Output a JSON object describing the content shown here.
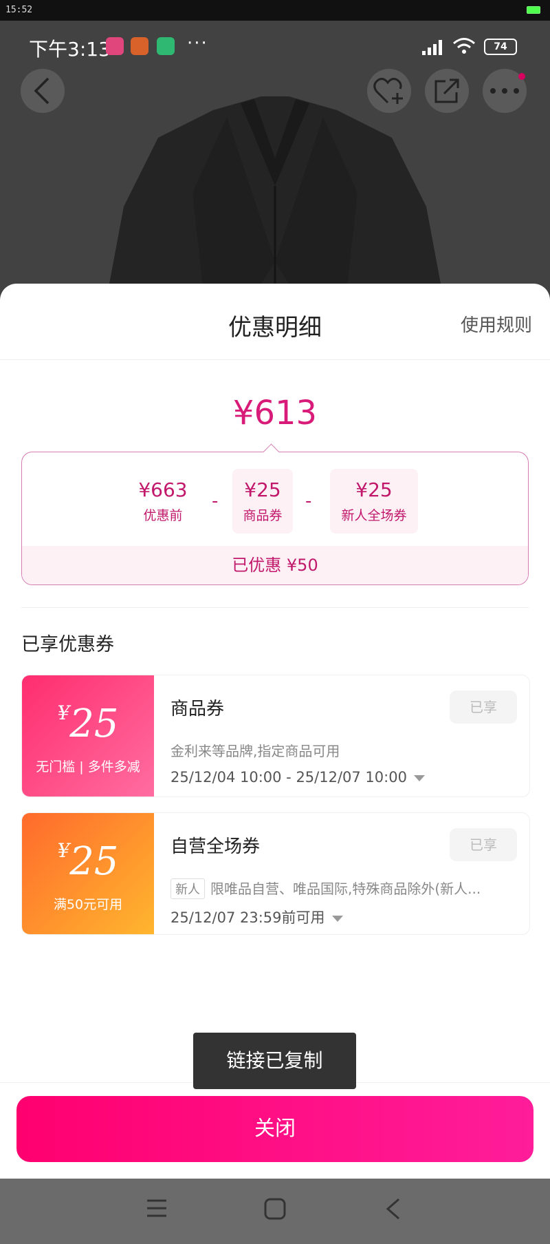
{
  "system_bar": {
    "time": "15:52"
  },
  "phone_status": {
    "time": "下午3:13",
    "more": "···",
    "battery": "74"
  },
  "sheet": {
    "title": "优惠明细",
    "rules_link": "使用规则",
    "final_price": "¥613",
    "breakdown": {
      "items": [
        {
          "value": "¥663",
          "label": "优惠前"
        },
        {
          "value": "¥25",
          "label": "商品券"
        },
        {
          "value": "¥25",
          "label": "新人全场券"
        }
      ],
      "minus": "-",
      "saved": "已优惠 ¥50"
    },
    "enjoyed_title": "已享优惠券",
    "coupons": [
      {
        "currency": "¥",
        "amount": "25",
        "condition": "无门槛 | 多件多减",
        "title": "商品券",
        "description": "金利来等品牌,指定商品可用",
        "tag": "",
        "validity": "25/12/04 10:00 - 25/12/07 10:00",
        "status": "已享",
        "color": "#ff3a7a"
      },
      {
        "currency": "¥",
        "amount": "25",
        "condition": "满50元可用",
        "title": "自营全场券",
        "description": "限唯品自营、唯品国际,特殊商品除外(新人...",
        "tag": "新人",
        "validity": "25/12/07 23:59前可用",
        "status": "已享",
        "color": "#ff8a2c"
      }
    ],
    "toast": "链接已复制",
    "close_button": "关闭"
  },
  "colors": {
    "accent": "#d81b78",
    "button": "#ff0a7e"
  }
}
